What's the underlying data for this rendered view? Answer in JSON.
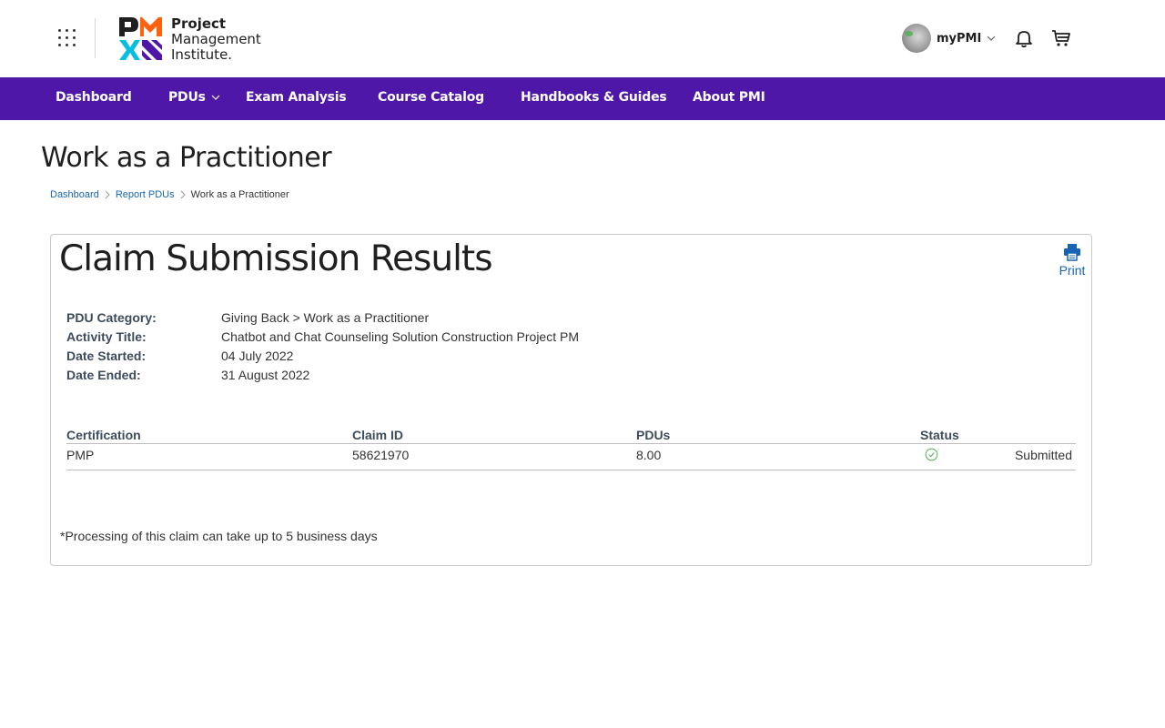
{
  "header": {
    "logo": {
      "line1": "Project",
      "line2": "Management",
      "line3": "Institute."
    },
    "user_label": "myPMI",
    "colors": {
      "logo_orange": "#ff610f",
      "logo_purple": "#4f17a8",
      "logo_cyan": "#05bfe0",
      "logo_dark": "#1f1f1f"
    }
  },
  "nav": {
    "background": "#4f17a8",
    "items": [
      {
        "label": "Dashboard"
      },
      {
        "label": "PDUs"
      },
      {
        "label": "Exam Analysis"
      },
      {
        "label": "Course Catalog"
      },
      {
        "label": "Handbooks & Guides"
      },
      {
        "label": "About PMI"
      }
    ]
  },
  "page": {
    "title": "Work as a Practitioner",
    "breadcrumb": {
      "dashboard": "Dashboard",
      "report_pdus": "Report PDUs",
      "current": "Work as a Practitioner"
    }
  },
  "card": {
    "title": "Claim Submission Results",
    "print_label": "Print",
    "info": [
      {
        "label": "PDU Category:",
        "value": "Giving Back > Work as a Practitioner"
      },
      {
        "label": "Activity Title:",
        "value": "Chatbot and Chat Counseling Solution Construction Project PM"
      },
      {
        "label": "Date Started:",
        "value": "04 July 2022"
      },
      {
        "label": "Date Ended:",
        "value": "31 August 2022"
      }
    ],
    "table": {
      "headers": {
        "certification": "Certification",
        "claim_id": "Claim ID",
        "pdus": "PDUs",
        "status": "Status"
      },
      "rows": [
        {
          "certification": "PMP",
          "claim_id": "58621970",
          "pdus": "8.00",
          "status": "Submitted"
        }
      ]
    },
    "note": "*Processing of this claim can take up to 5 business days"
  },
  "icons": {
    "apps": "grid-dots-icon",
    "bell": "bell-icon",
    "cart": "cart-icon",
    "print": "printer-icon",
    "status": "check-circle-icon",
    "status_color": "#4caf50",
    "link_color": "#1764b5"
  }
}
